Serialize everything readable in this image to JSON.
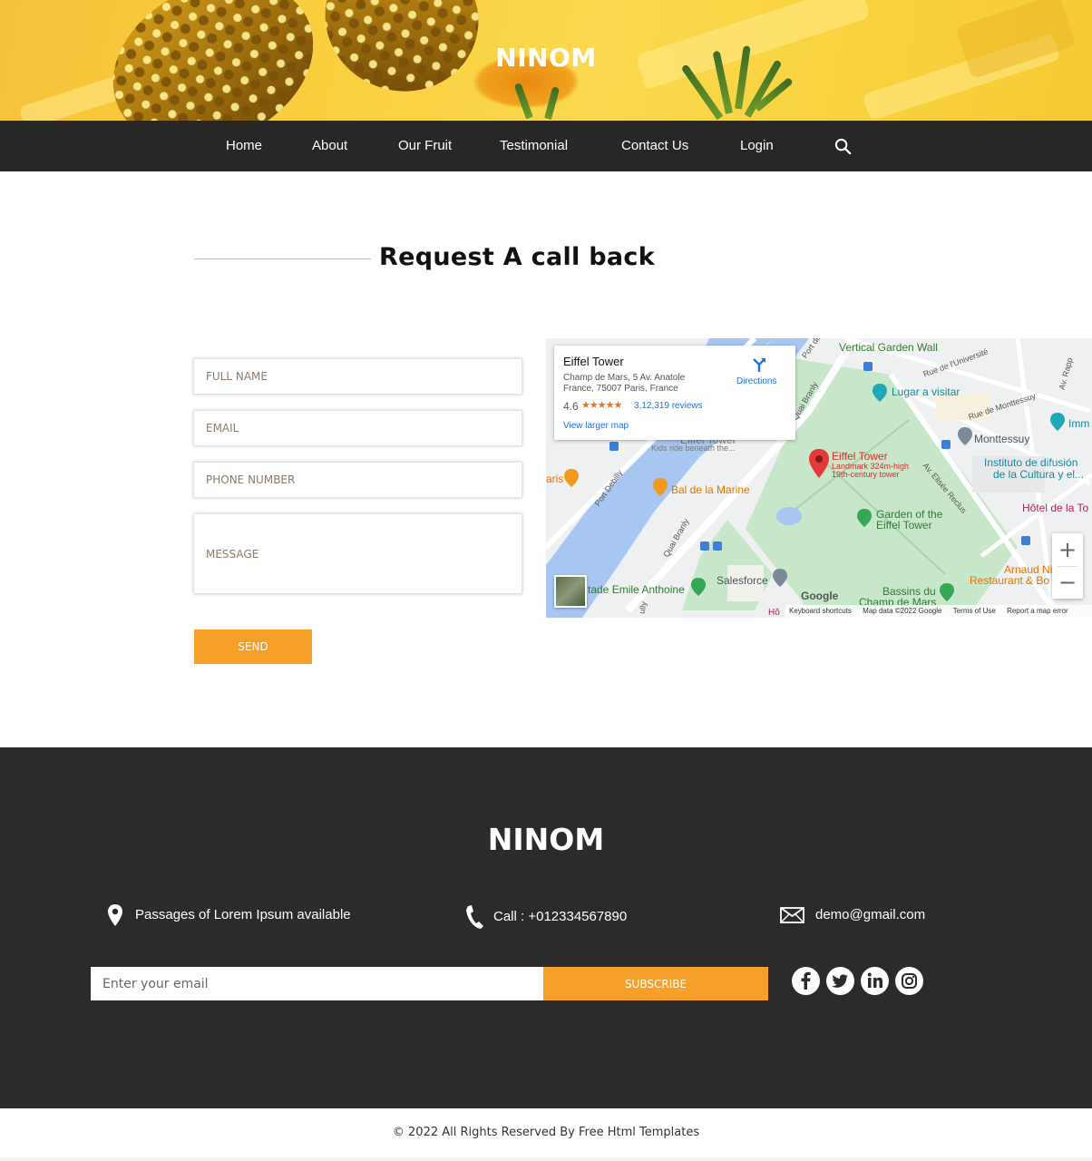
{
  "brand": "NINOM",
  "nav": {
    "items": [
      "Home",
      "About",
      "Our Fruit",
      "Testimonial",
      "Contact Us",
      "Login"
    ],
    "search_icon": "search-icon"
  },
  "contact": {
    "title": "Request A call back",
    "fields": {
      "full_name": "FULL NAME",
      "email": "EMAIL",
      "phone": "PHONE NUMBER",
      "message": "MESSAGE"
    },
    "send_label": "SEND"
  },
  "map": {
    "card": {
      "place": "Eiffel Tower",
      "address_line1": "Champ de Mars, 5 Av. Anatole",
      "address_line2": "France, 75007 Paris, France",
      "rating": "4.6",
      "stars": "★★★★★",
      "reviews": "3,12,319 reviews",
      "larger_map": "View larger map",
      "directions": "Directions"
    },
    "labels": {
      "vertical_garden": "Vertical Garden Wall",
      "rue_universite": "Rue de l'Université",
      "av_rapp": "Av. Rapp",
      "lugar": "Lugar a visitar",
      "rue_monttessuy": "Rue de Monttessuy",
      "imm": "Imm",
      "monttessuy": "Monttessuy",
      "instituto1": "Instituto de difusión",
      "instituto2": "de la Cultura y el...",
      "hotel_tour": "Hôtel de la To",
      "eiffel": "Eiffel Tower",
      "eiffel_sub1": "Landmark 324m-high",
      "eiffel_sub2": "19th-century tower",
      "kids": "Kids ride beneath the...",
      "eiffel_faded": "Eiffel Tower",
      "bal": "Bal de la Marine",
      "garden1": "Garden of the",
      "garden2": "Eiffel Tower",
      "port_debilly": "Port Debilly",
      "port_de": "Port de",
      "quai_branly_top": "Quai Branly",
      "quai_branly": "Quai Branly",
      "av_reclus": "Av. Elisée Reclus",
      "aris": "aris",
      "salesforce": "Salesforce",
      "stade": "tade Emile Anthoine",
      "bassins1": "Bassins du",
      "bassins2": "Champ de Mars",
      "arnaud1": "Arnaud Ni",
      "arnaud2": "Restaurant & Bo",
      "google": "Google",
      "hotel_bottom": "Hô",
      "ully": "ully"
    },
    "footer": {
      "shortcuts": "Keyboard shortcuts",
      "data": "Map data ©2022 Google",
      "terms": "Terms of Use",
      "report": "Report a map error"
    },
    "zoom_in": "+",
    "zoom_out": "−"
  },
  "footer": {
    "brand": "NINOM",
    "location_text": "Passages of Lorem Ipsum available",
    "call_text": "Call : +012334567890",
    "email_text": "demo@gmail.com",
    "email_placeholder": "Enter your email",
    "subscribe_label": "SUBSCRIBE",
    "social": [
      "facebook-icon",
      "twitter-icon",
      "linkedin-icon",
      "instagram-icon"
    ]
  },
  "copyright": "© 2022 All Rights Reserved By Free Html Templates",
  "colors": {
    "accent": "#f6a02a",
    "nav_bg": "#272727",
    "footer_bg": "#2b2b2b",
    "hero_yellow": "#f9cf3e"
  }
}
